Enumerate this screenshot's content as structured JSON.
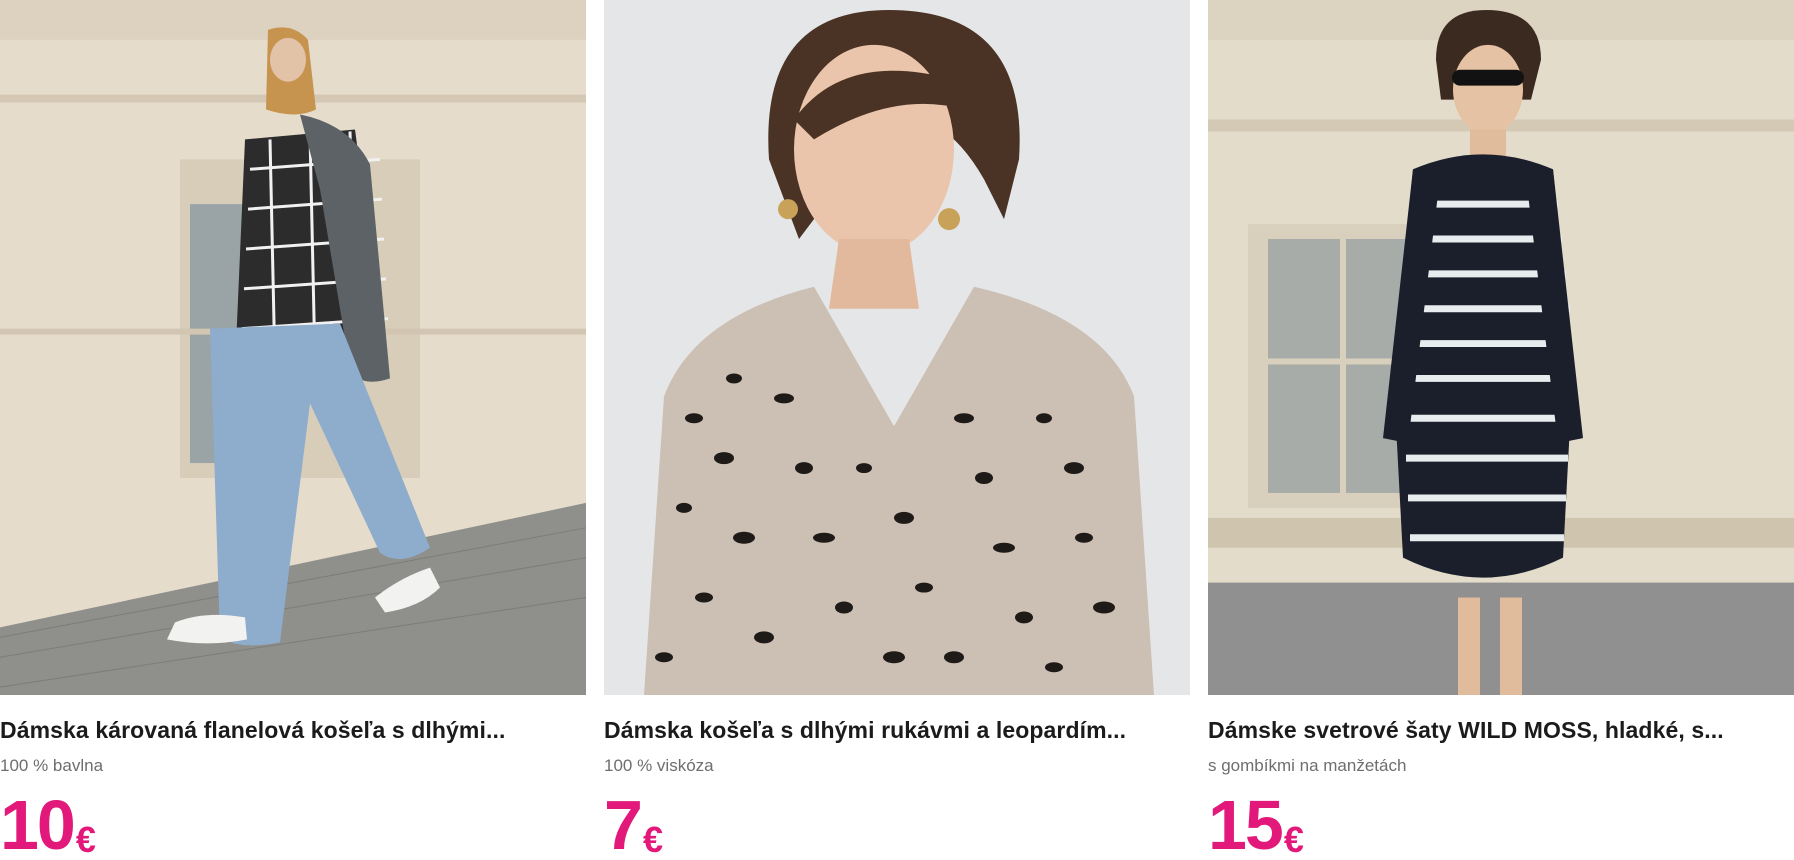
{
  "products": [
    {
      "title": "Dámska károvaná flanelová košeľa s dlhými...",
      "subtitle": "100 % bavlna",
      "price": "10",
      "currency": "€"
    },
    {
      "title": "Dámska košeľa s dlhými rukávmi a leopardím...",
      "subtitle": "100 % viskóza",
      "price": "7",
      "currency": "€"
    },
    {
      "title": "Dámske svetrové šaty WILD MOSS, hladké, s...",
      "subtitle": "s gombíkmi na manžetách",
      "price": "15",
      "currency": "€"
    }
  ],
  "colors": {
    "price": "#e2197a",
    "title": "#1b1b1b",
    "subtitle": "#6e6e6e"
  }
}
